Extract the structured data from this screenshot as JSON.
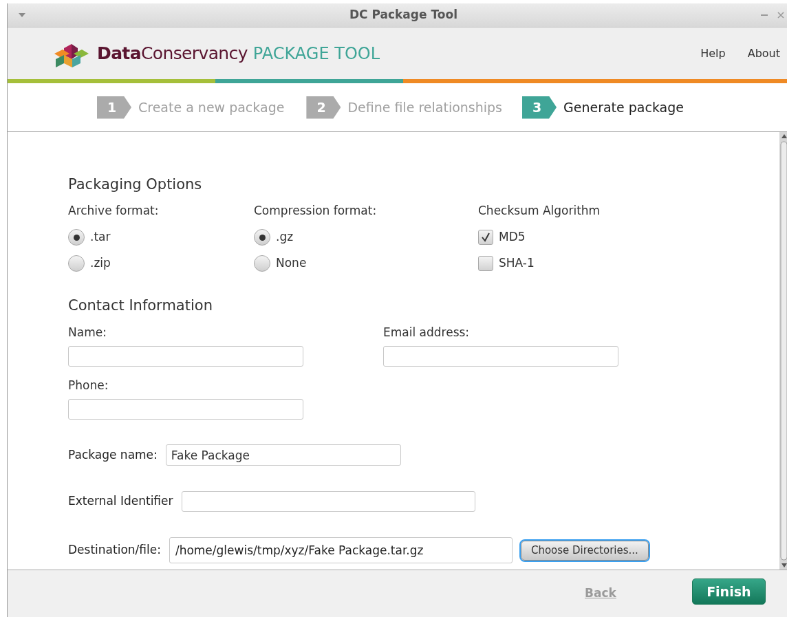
{
  "window": {
    "title": "DC Package Tool"
  },
  "header": {
    "logo_bold": "Data",
    "logo_light": "Conservancy",
    "logo_product": "PACKAGE TOOL",
    "nav": [
      "Help",
      "About"
    ]
  },
  "steps": [
    {
      "number": "1",
      "label": "Create a new package",
      "selected": false
    },
    {
      "number": "2",
      "label": "Define file relationships",
      "selected": false
    },
    {
      "number": "3",
      "label": "Generate package",
      "selected": true
    }
  ],
  "packaging_options": {
    "title": "Packaging Options",
    "archive_format": {
      "label": "Archive format:",
      "options": [
        {
          "label": ".tar",
          "selected": true
        },
        {
          "label": ".zip",
          "selected": false
        }
      ]
    },
    "compression_format": {
      "label": "Compression format:",
      "options": [
        {
          "label": ".gz",
          "selected": true
        },
        {
          "label": "None",
          "selected": false
        }
      ]
    },
    "checksum_algorithm": {
      "label": "Checksum Algorithm",
      "options": [
        {
          "label": "MD5",
          "checked": true
        },
        {
          "label": "SHA-1",
          "checked": false
        }
      ]
    }
  },
  "contact_information": {
    "title": "Contact Information",
    "name": {
      "label": "Name:"
    },
    "email": {
      "label": "Email address:"
    },
    "phone": {
      "label": "Phone:"
    }
  },
  "package_name": {
    "label": "Package name:",
    "value": "Fake Package"
  },
  "external_identifier": {
    "label": "External Identifier"
  },
  "destination": {
    "label": "Destination/file:",
    "value": "/home/glewis/tmp/xyz/Fake Package.tar.gz",
    "button": {
      "label": "Choose Directories...",
      "focused": true
    }
  },
  "footer": {
    "back": {
      "label": "Back",
      "disabled": true
    },
    "finish": {
      "label": "Finish",
      "disabled": false
    }
  }
}
